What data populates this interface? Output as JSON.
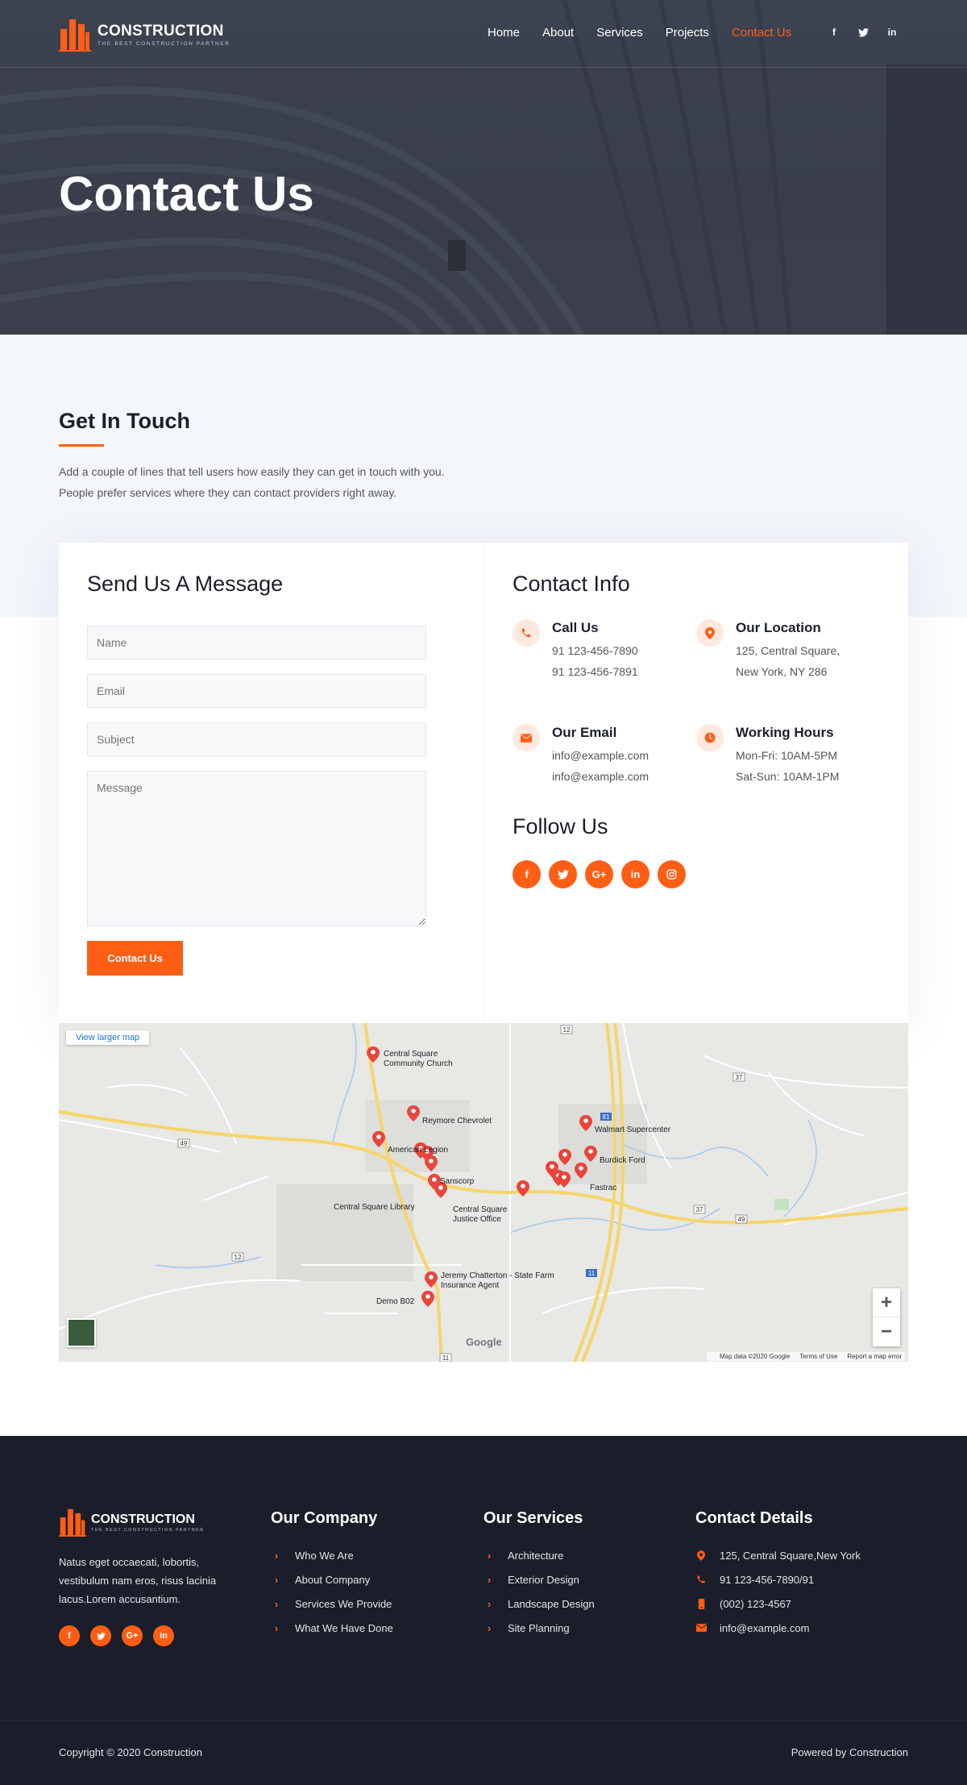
{
  "brand": {
    "name": "CONSTRUCTION",
    "tagline": "THE BEST CONSTRUCTION PARTNER",
    "accent": "#ff5e14"
  },
  "nav": {
    "items": [
      "Home",
      "About",
      "Services",
      "Projects",
      "Contact Us"
    ],
    "active": "Contact Us"
  },
  "header_social": [
    "facebook-icon",
    "twitter-icon",
    "linkedin-icon"
  ],
  "hero": {
    "title": "Contact Us"
  },
  "touch": {
    "title": "Get In Touch",
    "desc_line1": "Add a couple of lines that tell users how easily they can get in touch with you.",
    "desc_line2": "People prefer services where they can contact providers right away."
  },
  "form": {
    "title": "Send Us A Message",
    "name_placeholder": "Name",
    "email_placeholder": "Email",
    "subject_placeholder": "Subject",
    "message_placeholder": "Message",
    "submit_label": "Contact Us"
  },
  "contact_info": {
    "title": "Contact Info",
    "call": {
      "head": "Call Us",
      "line1": "91 123-456-7890",
      "line2": "91 123-456-7891"
    },
    "location": {
      "head": "Our Location",
      "line1": "125, Central Square,",
      "line2": "New York, NY 286"
    },
    "email": {
      "head": "Our Email",
      "line1": "info@example.com",
      "line2": "info@example.com"
    },
    "hours": {
      "head": "Working Hours",
      "line1": "Mon-Fri: 10AM-5PM",
      "line2": "Sat-Sun: 10AM-1PM"
    },
    "follow_title": "Follow Us",
    "follow_icons": [
      "facebook-icon",
      "twitter-icon",
      "google-plus-icon",
      "linkedin-icon",
      "instagram-icon"
    ]
  },
  "map": {
    "view_larger": "View larger map",
    "labels": {
      "church": "Central Square Community Church",
      "chevrolet": "Reymore Chevrolet",
      "legion": "American Legion",
      "sanscorp": "Sanscorp",
      "library": "Central Square Library",
      "justice": "Central Square Justice Office",
      "walmart": "Walmart Supercenter",
      "burdick": "Burdick Ford",
      "fastrac": "Fastrac",
      "jeremy": "Jeremy Chatterton - State Farm Insurance Agent",
      "demo": "Demo B02"
    },
    "route_labels": [
      "12",
      "37",
      "49",
      "81",
      "11",
      "37",
      "49",
      "12",
      "11"
    ],
    "google": "Google",
    "footer": {
      "data": "Map data ©2020 Google",
      "terms": "Terms of Use",
      "report": "Report a map error"
    },
    "zoom_in": "+",
    "zoom_out": "−"
  },
  "footer": {
    "about": "Natus eget occaecati, lobortis, vestibulum nam eros, risus lacinia lacus.Lorem accusantium.",
    "company": {
      "title": "Our Company",
      "items": [
        "Who We Are",
        "About Company",
        "Services We Provide",
        "What We Have Done"
      ]
    },
    "services": {
      "title": "Our Services",
      "items": [
        "Architecture",
        "Exterior Design",
        "Landscape Design",
        "Site Planning"
      ]
    },
    "contact": {
      "title": "Contact Details",
      "address": "125, Central Square,New York",
      "phone": "91 123-456-7890/91",
      "mobile": "(002) 123-4567",
      "email": "info@example.com"
    },
    "copyright": "Copyright © 2020 Construction",
    "powered": "Powered by Construction"
  }
}
